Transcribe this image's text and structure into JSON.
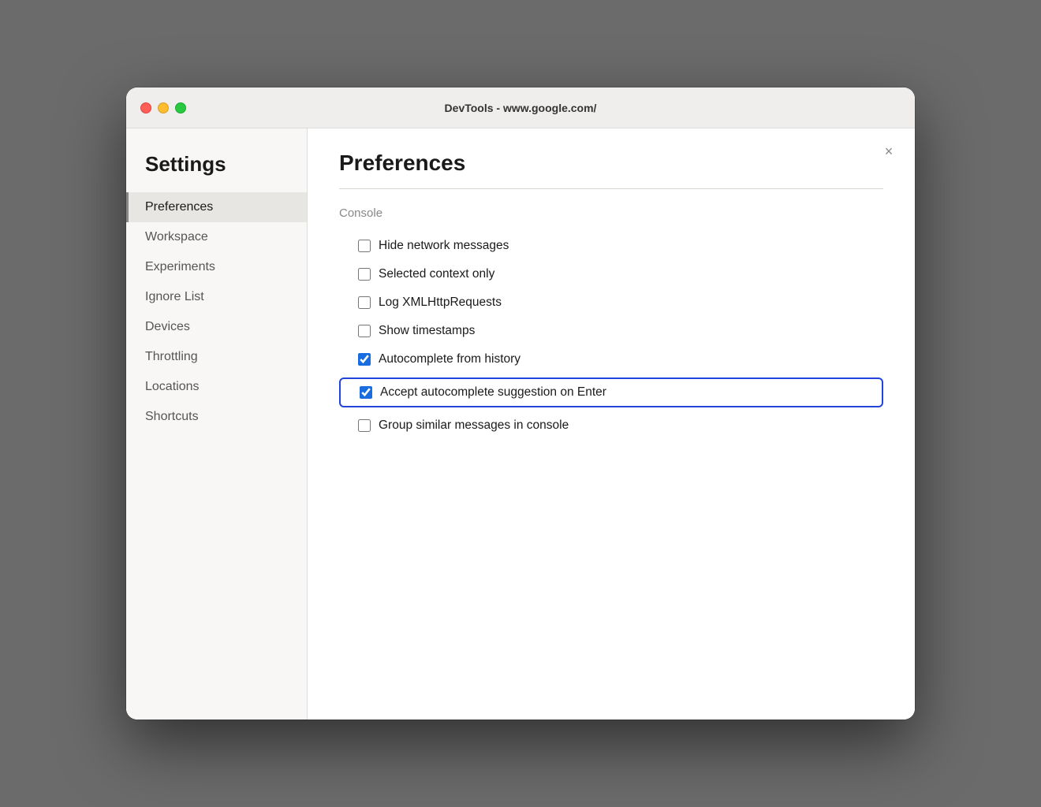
{
  "window": {
    "title": "DevTools - www.google.com/"
  },
  "sidebar": {
    "heading": "Settings",
    "items": [
      {
        "id": "preferences",
        "label": "Preferences",
        "active": true
      },
      {
        "id": "workspace",
        "label": "Workspace",
        "active": false
      },
      {
        "id": "experiments",
        "label": "Experiments",
        "active": false
      },
      {
        "id": "ignore-list",
        "label": "Ignore List",
        "active": false
      },
      {
        "id": "devices",
        "label": "Devices",
        "active": false
      },
      {
        "id": "throttling",
        "label": "Throttling",
        "active": false
      },
      {
        "id": "locations",
        "label": "Locations",
        "active": false
      },
      {
        "id": "shortcuts",
        "label": "Shortcuts",
        "active": false
      }
    ]
  },
  "main": {
    "section_title": "Preferences",
    "close_label": "×",
    "subsection": "Console",
    "checkboxes": [
      {
        "id": "hide-network",
        "label": "Hide network messages",
        "checked": false,
        "highlighted": false
      },
      {
        "id": "selected-context",
        "label": "Selected context only",
        "checked": false,
        "highlighted": false
      },
      {
        "id": "log-xml",
        "label": "Log XMLHttpRequests",
        "checked": false,
        "highlighted": false
      },
      {
        "id": "show-timestamps",
        "label": "Show timestamps",
        "checked": false,
        "highlighted": false
      },
      {
        "id": "autocomplete-history",
        "label": "Autocomplete from history",
        "checked": true,
        "highlighted": false
      },
      {
        "id": "accept-autocomplete",
        "label": "Accept autocomplete suggestion on Enter",
        "checked": true,
        "highlighted": true
      },
      {
        "id": "group-similar",
        "label": "Group similar messages in console",
        "checked": false,
        "highlighted": false
      }
    ]
  }
}
